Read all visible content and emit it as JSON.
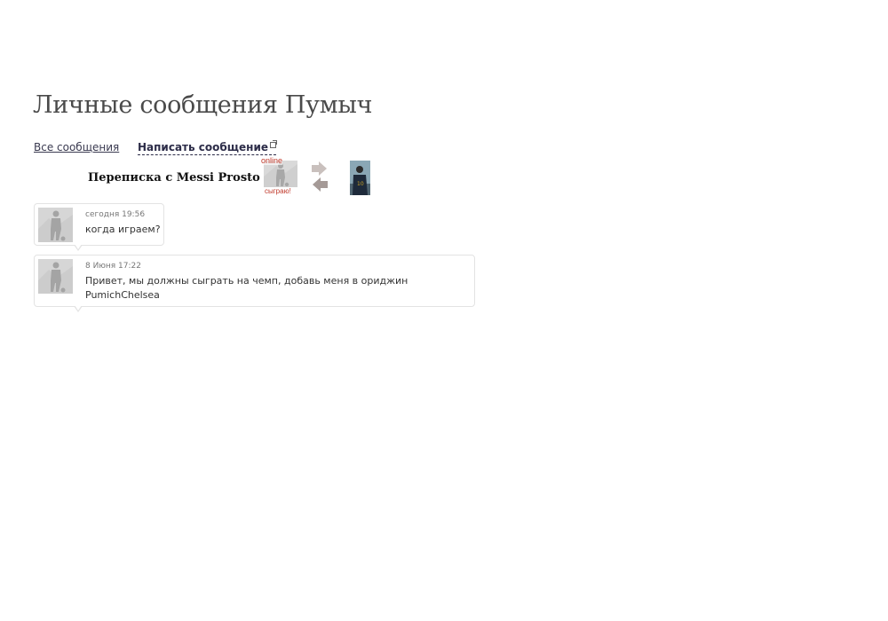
{
  "page": {
    "title": "Личные сообщения Пумыч"
  },
  "nav": {
    "all_messages": "Все сообщения",
    "write_message": "Написать сообщение"
  },
  "conversation": {
    "title": "Переписка с Messi Prosto",
    "me": {
      "status": "online",
      "tag": "сыграю!",
      "avatar_icon": "player-silhouette-icon"
    },
    "swap_icon": "swap-arrows-icon",
    "other": {
      "avatar_icon": "player-photo-icon"
    }
  },
  "messages": [
    {
      "date": "сегодня 19:56",
      "text": "когда играем?"
    },
    {
      "date": "8 Июня 17:22",
      "text_line1": "Привет, мы должны сыграть на чемп, добавь меня в ориджин",
      "text_line2": "PumichChelsea"
    }
  ],
  "colors": {
    "status_red": "#c0392b",
    "bubble_border": "#e3e3e3",
    "link": "#3a3a50"
  }
}
